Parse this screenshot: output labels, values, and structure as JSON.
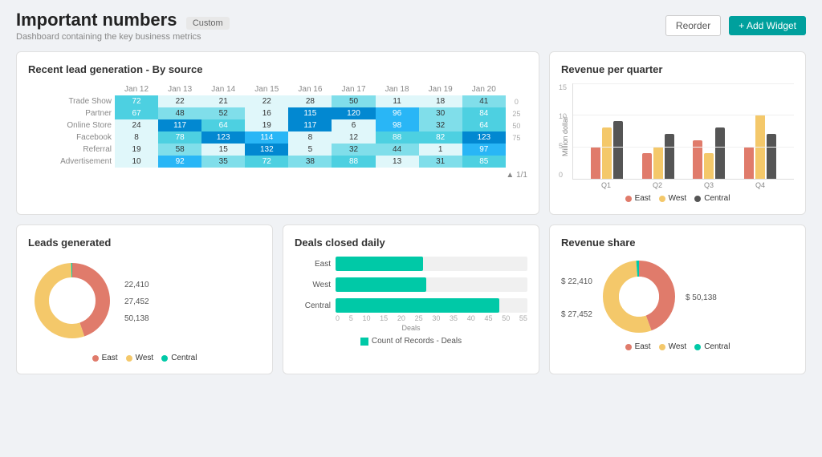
{
  "header": {
    "title": "Important numbers",
    "badge": "Custom",
    "subtitle": "Dashboard containing the key business metrics",
    "reorder_label": "Reorder",
    "add_widget_label": "+ Add Widget"
  },
  "lead_gen": {
    "title": "Recent lead generation - By source",
    "rows": [
      {
        "label": "Trade Show",
        "values": [
          72,
          22,
          21,
          22,
          28,
          50,
          11,
          18,
          41
        ]
      },
      {
        "label": "Partner",
        "values": [
          67,
          48,
          52,
          16,
          115,
          120,
          96,
          30,
          84
        ]
      },
      {
        "label": "Online Store",
        "values": [
          24,
          117,
          64,
          19,
          117,
          6,
          98,
          32,
          64
        ]
      },
      {
        "label": "Facebook",
        "values": [
          8,
          78,
          123,
          114,
          8,
          12,
          88,
          82,
          123
        ]
      },
      {
        "label": "Referral",
        "values": [
          19,
          58,
          15,
          132,
          5,
          32,
          44,
          1,
          97
        ]
      },
      {
        "label": "Advertisement",
        "values": [
          10,
          92,
          35,
          72,
          38,
          88,
          13,
          31,
          85
        ]
      }
    ],
    "col_labels": [
      "Jan 12",
      "Jan 13",
      "Jan 14",
      "Jan 15",
      "Jan 16",
      "Jan 17",
      "Jan 18",
      "Jan 19",
      "Jan 20"
    ],
    "pagination": "1/1"
  },
  "revenue_quarter": {
    "title": "Revenue per quarter",
    "y_label": "Million dollar",
    "y_ticks": [
      "15",
      "10",
      "5",
      "0"
    ],
    "quarters": [
      "Q1",
      "Q2",
      "Q3",
      "Q4"
    ],
    "east": [
      5,
      4,
      6,
      5
    ],
    "west": [
      8,
      5,
      4,
      10
    ],
    "central": [
      9,
      7,
      8,
      7
    ],
    "legend": {
      "east": "East",
      "west": "West",
      "central": "Central"
    }
  },
  "leads_generated": {
    "title": "Leads generated",
    "total": "50,138",
    "segments": {
      "east": {
        "value": "22,410",
        "color": "#e07b6b",
        "label": "East"
      },
      "west": {
        "value": "27,452",
        "color": "#f4c86a",
        "label": "West"
      },
      "central": {
        "color": "#00c9a7",
        "label": "Central"
      }
    }
  },
  "deals_closed": {
    "title": "Deals closed daily",
    "bars": [
      {
        "label": "East",
        "value": 25,
        "max": 55
      },
      {
        "label": "West",
        "value": 26,
        "max": 55
      },
      {
        "label": "Central",
        "value": 47,
        "max": 55
      }
    ],
    "axis_ticks": [
      "0",
      "5",
      "10",
      "15",
      "20",
      "25",
      "30",
      "35",
      "40",
      "45",
      "50",
      "55"
    ],
    "axis_label": "Deals",
    "legend_label": "Count of Records - Deals"
  },
  "revenue_share": {
    "title": "Revenue share",
    "label_left_top": "$ 22,410",
    "label_left_bottom": "$ 27,452",
    "label_right": "$ 50,138",
    "segments": {
      "east": {
        "color": "#e07b6b",
        "label": "East"
      },
      "west": {
        "color": "#f4c86a",
        "label": "West"
      },
      "central": {
        "color": "#00c9a7",
        "label": "Central"
      }
    }
  }
}
